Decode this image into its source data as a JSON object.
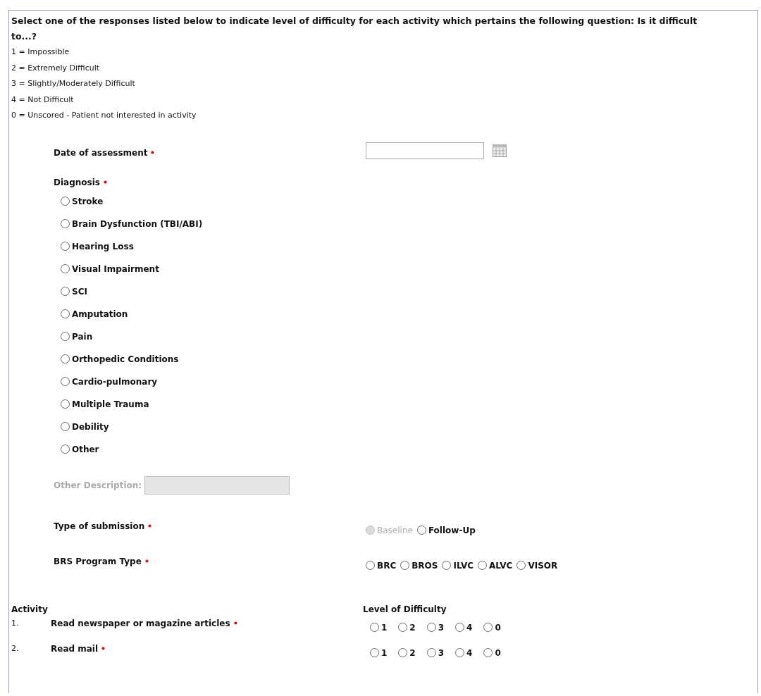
{
  "instructions": {
    "intro": "Select one of the responses listed below to indicate level of difficulty for each activity which pertains the following question: Is it difficult to...?",
    "scale": [
      "1 = Impossible",
      "2 = Extremely Difficult",
      "3 = Slightly/Moderately Difficult",
      "4 = Not Difficult",
      "0 = Unscored - Patient not interested in activity"
    ]
  },
  "date_of_assessment": {
    "label": "Date of assessment",
    "required": true
  },
  "diagnosis": {
    "label": "Diagnosis",
    "required": true,
    "options": [
      {
        "label": "Stroke",
        "selected": false
      },
      {
        "label": "Brain Dysfunction (TBI/ABI)",
        "selected": false
      },
      {
        "label": "Hearing Loss",
        "selected": false
      },
      {
        "label": "Visual Impairment",
        "selected": false
      },
      {
        "label": "SCI",
        "selected": false
      },
      {
        "label": "Amputation",
        "selected": false
      },
      {
        "label": "Pain",
        "selected": false
      },
      {
        "label": "Orthopedic Conditions",
        "selected": false
      },
      {
        "label": "Cardio-pulmonary",
        "selected": false
      },
      {
        "label": "Multiple Trauma",
        "selected": false
      },
      {
        "label": "Debility",
        "selected": false
      },
      {
        "label": "Other",
        "selected": false
      }
    ]
  },
  "other_description": {
    "label": "Other Description:",
    "disabled": true
  },
  "type_of_submission": {
    "label": "Type of submission",
    "required": true,
    "options": [
      {
        "label": "Baseline",
        "selected": false,
        "disabled": true
      },
      {
        "label": "Follow-Up",
        "selected": false,
        "disabled": false
      }
    ]
  },
  "program_type": {
    "label": "BRS Program Type",
    "required": true,
    "options": [
      {
        "label": "BRC",
        "selected": false
      },
      {
        "label": "BROS",
        "selected": false
      },
      {
        "label": "ILVC",
        "selected": false
      },
      {
        "label": "ALVC",
        "selected": false
      },
      {
        "label": "VISOR",
        "selected": false
      }
    ]
  },
  "activities": {
    "activity_heading": "Activity",
    "level_heading": "Level of Difficulty",
    "rows": [
      {
        "number": "1.",
        "label": "Read newspaper or magazine articles",
        "required": true,
        "options": [
          {
            "label": "1",
            "selected": false
          },
          {
            "label": "2",
            "selected": false
          },
          {
            "label": "3",
            "selected": false
          },
          {
            "label": "4",
            "selected": false
          },
          {
            "label": "0",
            "selected": false
          }
        ]
      },
      {
        "number": "2.",
        "label": "Read mail",
        "required": true,
        "options": [
          {
            "label": "1",
            "selected": false
          },
          {
            "label": "2",
            "selected": false
          },
          {
            "label": "3",
            "selected": false
          },
          {
            "label": "4",
            "selected": false
          },
          {
            "label": "0",
            "selected": false
          }
        ]
      }
    ]
  }
}
